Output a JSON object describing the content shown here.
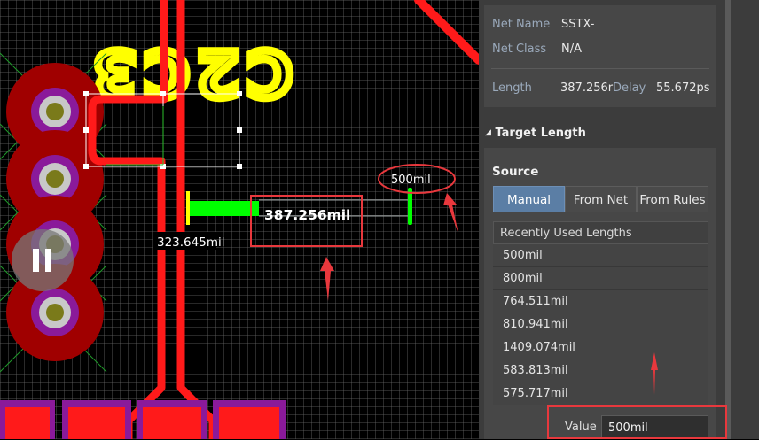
{
  "canvas": {
    "designator_text": "C2C3",
    "measure_left": "323.645mil",
    "measure_main": "387.256mil",
    "target_bubble": "500mil",
    "colors": {
      "trace": "#ff1a1a",
      "pad": "#a00000",
      "via_ring": "#8a1a9a",
      "silk": "#ffff00",
      "tuning": "#00ff00",
      "annotation": "#e8383d"
    }
  },
  "panel": {
    "net_name_label": "Net Name",
    "net_name_value": "SSTX-",
    "net_class_label": "Net Class",
    "net_class_value": "N/A",
    "length_label": "Length",
    "length_value": "387.256r",
    "delay_label": "Delay",
    "delay_value": "55.672ps",
    "section_title": "Target Length",
    "source_label": "Source",
    "source_buttons": [
      "Manual",
      "From Net",
      "From Rules"
    ],
    "selected_source": "Manual",
    "recent_header": "Recently Used Lengths",
    "recent_lengths": [
      "500mil",
      "800mil",
      "764.511mil",
      "810.941mil",
      "1409.074mil",
      "583.813mil",
      "575.717mil"
    ],
    "value_label": "Value",
    "value": "500mil"
  },
  "icons": {
    "pause": "pause-icon",
    "collapse": "triangle-down-icon"
  }
}
